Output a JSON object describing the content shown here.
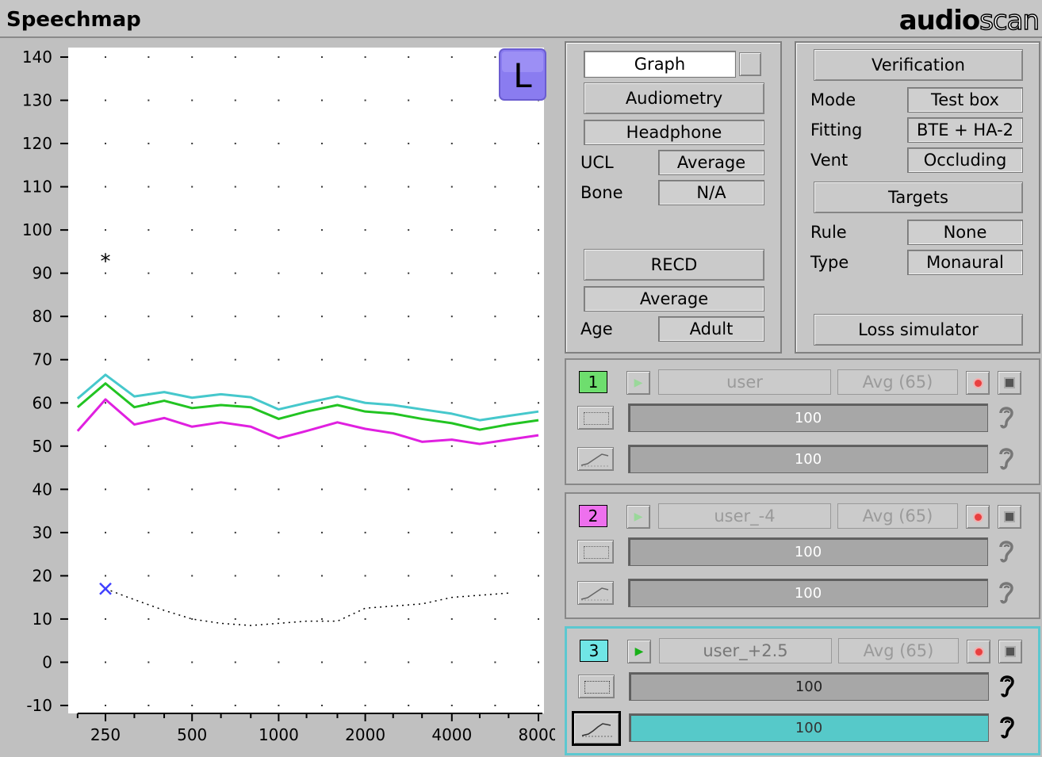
{
  "title": "Speechmap",
  "brand": {
    "part1": "audio",
    "part2": "scan"
  },
  "ear_badge": "L",
  "colors": {
    "accent_cyan": "#56c9c9",
    "curve_cyan": "#46c8cc",
    "curve_green": "#22c422",
    "curve_magenta": "#e020e0",
    "badge": "#8a7cf0"
  },
  "chart_data": {
    "type": "line",
    "xlabel": "",
    "ylabel": "",
    "x_scale": "log",
    "xlim": [
      180,
      8000
    ],
    "ylim": [
      -10,
      140
    ],
    "grid": "dots",
    "y_ticks": [
      "140",
      "130",
      "120",
      "110",
      "100",
      "90",
      "80",
      "70",
      "60",
      "50",
      "40",
      "30",
      "20",
      "10",
      "0",
      "-10"
    ],
    "x_ticks": [
      "250",
      "500",
      "1000",
      "2000",
      "4000",
      "8000"
    ],
    "x": [
      200,
      250,
      315,
      400,
      500,
      630,
      800,
      1000,
      1250,
      1600,
      2000,
      2500,
      3150,
      4000,
      5000,
      6300,
      8000
    ],
    "series": [
      {
        "color": "#46c8cc",
        "values": [
          61,
          66.5,
          61.5,
          62.5,
          61.2,
          62,
          61.3,
          58.5,
          60,
          61.5,
          60,
          59.5,
          58.5,
          57.5,
          56,
          57,
          58
        ]
      },
      {
        "color": "#22c422",
        "values": [
          59,
          64.5,
          59,
          60.5,
          58.8,
          59.5,
          59,
          56.3,
          58,
          59.5,
          58,
          57.5,
          56.3,
          55.3,
          53.8,
          55,
          56
        ]
      },
      {
        "color": "#e020e0",
        "values": [
          53.5,
          60.8,
          55,
          56.5,
          54.5,
          55.5,
          54.5,
          51.8,
          53.5,
          55.5,
          54,
          53,
          51,
          51.5,
          50.5,
          51.5,
          52.5
        ]
      }
    ],
    "threshold": {
      "marker": "x",
      "color": "#4040ff",
      "x": [
        250,
        300,
        400,
        500,
        630,
        800,
        1000,
        1250,
        1600,
        2000,
        2500,
        3150,
        4000,
        5000,
        6300
      ],
      "values": [
        17,
        15,
        12,
        10,
        9,
        8.5,
        9,
        9.5,
        9.5,
        12.5,
        13,
        13.5,
        15,
        15.5,
        16
      ]
    },
    "ucl_point": {
      "marker": "*",
      "x": 250,
      "y": 93
    }
  },
  "audiometry_panel": {
    "graph_label": "Graph",
    "audiometry_label": "Audiometry",
    "transducer": "Headphone",
    "ucl_label": "UCL",
    "ucl_value": "Average",
    "bone_label": "Bone",
    "bone_value": "N/A",
    "recd_label": "RECD",
    "recd_value": "Average",
    "age_label": "Age",
    "age_value": "Adult"
  },
  "verification_panel": {
    "verification_label": "Verification",
    "mode_label": "Mode",
    "mode_value": "Test box",
    "fitting_label": "Fitting",
    "fitting_value": "BTE + HA-2",
    "vent_label": "Vent",
    "vent_value": "Occluding",
    "targets_label": "Targets",
    "rule_label": "Rule",
    "rule_value": "None",
    "type_label": "Type",
    "type_value": "Monaural",
    "loss_sim_label": "Loss simulator"
  },
  "channels": [
    {
      "num": "1",
      "color": "#6ede6e",
      "name": "user",
      "stimulus": "Avg (65)",
      "level1": "100",
      "level2": "100"
    },
    {
      "num": "2",
      "color": "#ee70ee",
      "name": "user_-4",
      "stimulus": "Avg (65)",
      "level1": "100",
      "level2": "100"
    },
    {
      "num": "3",
      "color": "#70e6e6",
      "name": "user_+2.5",
      "stimulus": "Avg (65)",
      "level1": "100",
      "level2": "100"
    }
  ]
}
